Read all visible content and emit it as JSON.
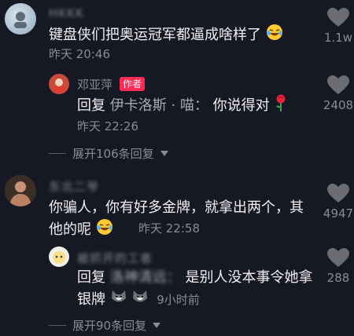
{
  "comments": [
    {
      "username": "HKKK",
      "text": "键盘侠们把奥运冠军都逼成啥样了",
      "time": "昨天 20:46",
      "likes": "1.1w"
    },
    {
      "username": "邓亚萍",
      "badge": "作者",
      "reply_prefix": "回复",
      "reply_to": "伊卡洛斯 · 喵：",
      "text": "你说得对",
      "time": "昨天 22:26",
      "likes": "2408"
    },
    {
      "username": "东北二爷",
      "text": "你骗人，你有好多金牌，就拿出两个，其他的呢",
      "time": "昨天 22:58",
      "likes": "4947"
    },
    {
      "username": "被抓开的工者",
      "reply_prefix": "回复",
      "reply_to": "洛神清远：",
      "text": "是别人没本事令她拿银牌",
      "time": "9小时前",
      "likes": "288"
    }
  ],
  "expand_1": "展开106条回复",
  "expand_2": "展开90条回复",
  "colors": {
    "background": "#161823",
    "secondary_text": "#8a8b91",
    "badge": "#fe2c55"
  },
  "icons": {
    "like": "heart-icon",
    "expand": "caret-down-icon"
  }
}
